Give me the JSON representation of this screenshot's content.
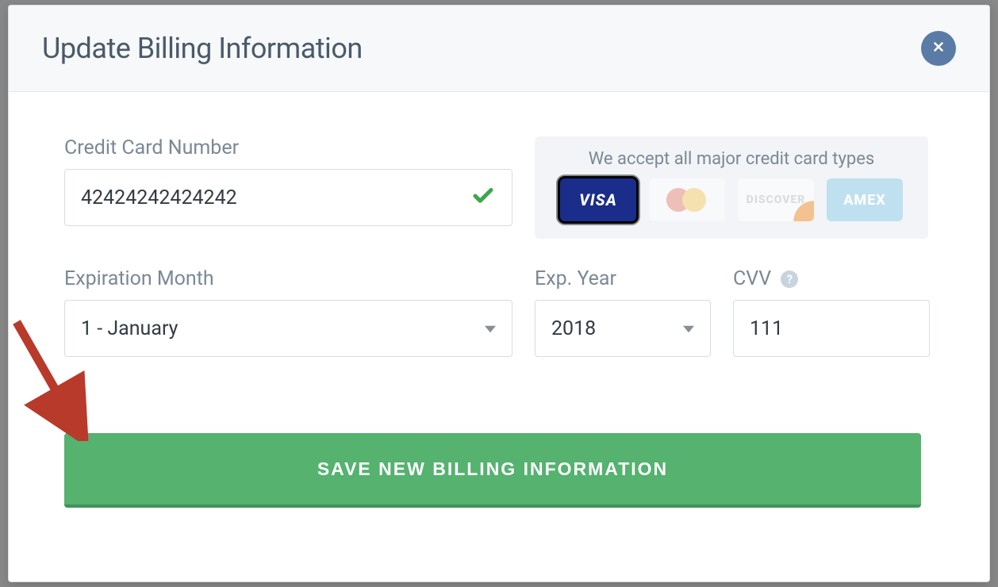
{
  "modal": {
    "title": "Update Billing Information"
  },
  "cc": {
    "label": "Credit Card Number",
    "value": "42424242424242"
  },
  "accept": {
    "text": "We accept all major credit card types",
    "visa": "VISA",
    "discover": "DISCOVER",
    "amex": "AMEX"
  },
  "exp_month": {
    "label": "Expiration Month",
    "value": "1 - January"
  },
  "exp_year": {
    "label": "Exp. Year",
    "value": "2018"
  },
  "cvv": {
    "label": "CVV",
    "value": "111",
    "help": "?"
  },
  "save": {
    "label": "SAVE NEW BILLING INFORMATION"
  }
}
